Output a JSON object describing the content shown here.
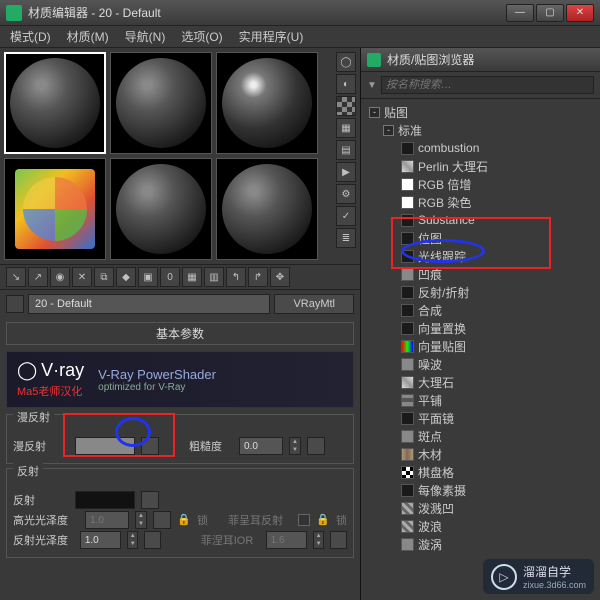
{
  "window": {
    "title": "材质编辑器 - 20 - Default",
    "min": "—",
    "max": "▢",
    "close": "✕"
  },
  "menu": {
    "modes": "模式(D)",
    "material": "材质(M)",
    "navigation": "导航(N)",
    "options": "选项(O)",
    "utilities": "实用程序(U)"
  },
  "slot": {
    "name": "20 - Default",
    "type": "VRayMtl"
  },
  "rollouts": {
    "basic": "基本参数"
  },
  "vray": {
    "logo": "V·ray",
    "title": "V-Ray PowerShader",
    "subtitle": "optimized for V-Ray",
    "hanhua": "Ma5老师汉化"
  },
  "params": {
    "diffuse_group": "漫反射",
    "diffuse": "漫反射",
    "roughness": "粗糙度",
    "roughness_val": "0.0",
    "reflect_group": "反射",
    "reflect": "反射",
    "hilight": "高光光泽度",
    "hilight_val": "1.0",
    "lock": "锁",
    "fresnel": "菲呈耳反射",
    "refl_gloss": "反射光泽度",
    "refl_gloss_val": "1.0",
    "fresnel_ior": "菲涅耳IOR",
    "fresnel_ior_val": "1.6"
  },
  "browser": {
    "title": "材质/贴图浏览器",
    "search_placeholder": "按名称搜索…",
    "root": "贴图",
    "standard": "标准",
    "items": {
      "combustion": "combustion",
      "perlin": "Perlin 大理石",
      "rgbmult": "RGB 倍增",
      "rgbtint": "RGB 染色",
      "substance": "Substance",
      "bitmap": "位图",
      "raytrace": "光线跟踪",
      "dent": "凹痕",
      "reflrefr": "反射/折射",
      "composite": "合成",
      "vdisp": "向量置换",
      "vmap": "向量贴图",
      "noise": "噪波",
      "marble": "大理石",
      "tiles": "平铺",
      "flatmirror": "平面镜",
      "speckle": "斑点",
      "wood": "木材",
      "checker": "棋盘格",
      "perpixel": "每像素摄",
      "splat": "泼溅凹",
      "waves": "波浪",
      "swirl": "漩涡"
    }
  },
  "watermark": {
    "brand": "溜溜自学",
    "url": "zixue.3d66.com"
  }
}
